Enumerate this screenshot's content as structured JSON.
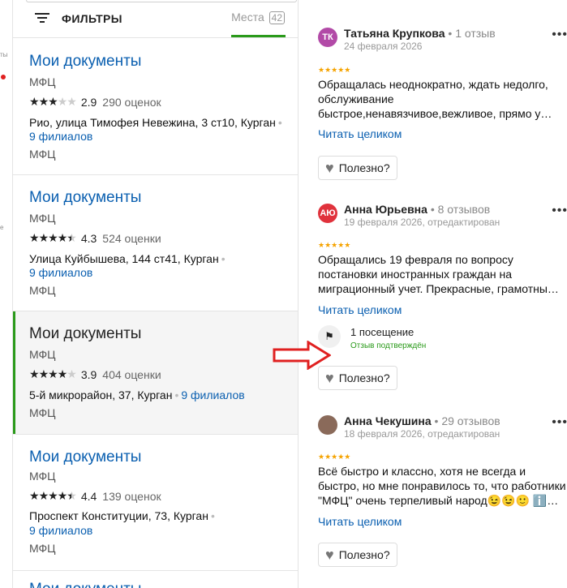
{
  "left_fragments": [
    "ты",
    "е"
  ],
  "filters": {
    "label": "ФИЛЬТРЫ",
    "tab_label": "Места",
    "tab_count": "42"
  },
  "orgs": [
    {
      "title": "Мои документы",
      "category": "МФЦ",
      "rating": "2.9",
      "stars_on": 3,
      "ratings_count": "290 оценок",
      "address": "Рио, улица Тимофея Невежина, 3 ст10, Курган",
      "branches": "9 филиалов",
      "extra": "МФЦ"
    },
    {
      "title": "Мои документы",
      "category": "МФЦ",
      "rating": "4.3",
      "stars_on": 4.5,
      "ratings_count": "524 оценки",
      "address": "Улица Куйбышева, 144 ст41, Курган",
      "branches": "9 филиалов",
      "extra": "МФЦ"
    },
    {
      "title": "Мои документы",
      "category": "МФЦ",
      "rating": "3.9",
      "stars_on": 4,
      "ratings_count": "404 оценки",
      "address": "5-й микрорайон, 37, Курган",
      "branches": "9 филиалов",
      "extra": "МФЦ"
    },
    {
      "title": "Мои документы",
      "category": "МФЦ",
      "rating": "4.4",
      "stars_on": 4.5,
      "ratings_count": "139 оценок",
      "address": "Проспект Конституции, 73, Курган",
      "branches": "9 филиалов",
      "extra": "МФЦ"
    },
    {
      "title": "Мои документы"
    }
  ],
  "reviews": [
    {
      "initials": "ТК",
      "avatar_color": "#b24aa7",
      "name": "Татьяна Крупкова",
      "count": "1 отзыв",
      "date": "24 февраля 2026",
      "text": "Обращалась неоднократно, ждать недолго, обслуживание быстрое,ненавязчивое,вежливое, прямо у…",
      "read_all": "Читать целиком",
      "helpful": "Полезно?"
    },
    {
      "initials": "АЮ",
      "avatar_color": "#e0323c",
      "name": "Анна Юрьевна",
      "count": "8 отзывов",
      "date": "19 февраля 2026, отредактирован",
      "text": "Обращались 19 февраля по вопросу постановки иностранных граждан на миграционный учет. Прекрасные, грамотны…",
      "read_all": "Читать целиком",
      "visit": "1 посещение",
      "visit_confirmed": "Отзыв подтверждён",
      "helpful": "Полезно?"
    },
    {
      "initials": "",
      "avatar_color": "#8a6a5a",
      "name": "Анна Чекушина",
      "count": "29 отзывов",
      "date": "18 февраля 2026, отредактирован",
      "text": "Всё быстро и классно, хотя не всегда и быстро, но мне понравилось то, что работники \"МФЦ\" очень терпеливый народ😉😉🙂 ℹ️…",
      "read_all": "Читать целиком",
      "helpful": "Полезно?"
    }
  ],
  "colors": {
    "link": "#0a5fb0",
    "accent_green": "#2a9a1a",
    "arrow_red": "#e02020",
    "review_stars": "#f5a300"
  }
}
